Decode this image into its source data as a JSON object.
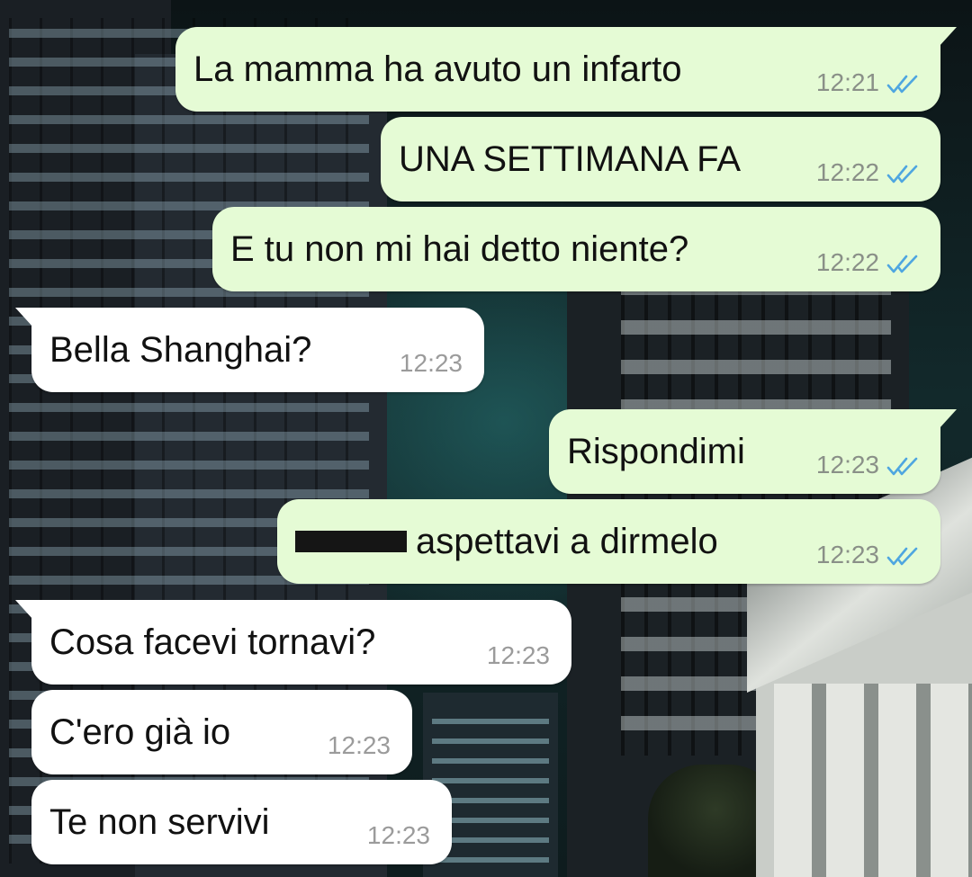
{
  "colors": {
    "outgoing_bubble": "#e5fbd5",
    "incoming_bubble": "#ffffff",
    "read_ticks": "#4fa6e0",
    "timestamp": "#8a9088"
  },
  "messages": [
    {
      "direction": "outgoing",
      "text": "La mamma ha avuto un infarto",
      "time": "12:21",
      "status_icon": "double-check-read-icon"
    },
    {
      "direction": "outgoing",
      "text": "UNA SETTIMANA FA",
      "time": "12:22",
      "status_icon": "double-check-read-icon"
    },
    {
      "direction": "outgoing",
      "text": "E tu non mi hai detto niente?",
      "time": "12:22",
      "status_icon": "double-check-read-icon"
    },
    {
      "direction": "incoming",
      "text": "Bella Shanghai?",
      "time": "12:23"
    },
    {
      "direction": "outgoing",
      "text": "Rispondimi",
      "time": "12:23",
      "status_icon": "double-check-read-icon"
    },
    {
      "direction": "outgoing",
      "text": "aspettavi a dirmelo",
      "redacted_prefix": true,
      "time": "12:23",
      "status_icon": "double-check-read-icon"
    },
    {
      "direction": "incoming",
      "text": "Cosa facevi tornavi?",
      "time": "12:23"
    },
    {
      "direction": "incoming",
      "text": "C'ero già io",
      "time": "12:23"
    },
    {
      "direction": "incoming",
      "text": "Te non servivi",
      "time": "12:23"
    }
  ]
}
